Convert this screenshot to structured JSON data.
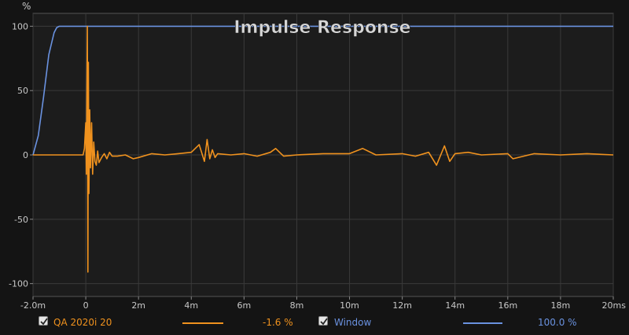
{
  "chart_data": {
    "type": "line",
    "title": "Impulse Response",
    "ylabel": "%",
    "xlabel": "",
    "xlim": [
      -2.0,
      20
    ],
    "ylim": [
      -110,
      110
    ],
    "x_ticks": [
      -2,
      0,
      2,
      4,
      6,
      8,
      10,
      12,
      14,
      16,
      18,
      20
    ],
    "x_tick_labels": [
      "-2.0m",
      "0",
      "2m",
      "4m",
      "6m",
      "8m",
      "10m",
      "12m",
      "14m",
      "16m",
      "18m",
      "20ms"
    ],
    "y_ticks": [
      100,
      50,
      0,
      -50,
      -100
    ],
    "y_tick_labels": [
      "100",
      "50",
      "0",
      "-50",
      "-100"
    ],
    "grid": true,
    "series": [
      {
        "name": "QA 2020i 20",
        "color": "#f0921e",
        "x": [
          -2.0,
          -0.1,
          -0.05,
          0.0,
          0.02,
          0.04,
          0.06,
          0.08,
          0.1,
          0.12,
          0.15,
          0.18,
          0.22,
          0.26,
          0.3,
          0.35,
          0.4,
          0.45,
          0.5,
          0.6,
          0.7,
          0.8,
          0.9,
          1.0,
          1.2,
          1.5,
          1.8,
          2.0,
          2.5,
          3.0,
          3.5,
          4.0,
          4.3,
          4.5,
          4.6,
          4.7,
          4.8,
          4.9,
          5.0,
          5.5,
          6.0,
          6.5,
          7.0,
          7.2,
          7.5,
          8.0,
          9.0,
          10.0,
          10.5,
          11.0,
          12.0,
          12.5,
          13.0,
          13.3,
          13.6,
          13.8,
          14.0,
          14.5,
          15.0,
          16.0,
          16.2,
          17.0,
          18.0,
          19.0,
          20.0
        ],
        "y": [
          0,
          0,
          5,
          25,
          -15,
          40,
          100,
          -91,
          72,
          -30,
          35,
          -10,
          25,
          -15,
          10,
          -5,
          -8,
          3,
          -6,
          -2,
          1,
          -3,
          2,
          -1,
          -1,
          0,
          -3,
          -2,
          1,
          0,
          1,
          2,
          8,
          -5,
          12,
          -3,
          4,
          -2,
          1,
          0,
          1,
          -1,
          2,
          5,
          -1,
          0,
          1,
          1,
          5,
          0,
          1,
          -1,
          2,
          -8,
          7,
          -5,
          1,
          2,
          0,
          1,
          -3,
          1,
          0,
          1,
          0
        ]
      },
      {
        "name": "Window",
        "color": "#6a92e0",
        "x": [
          -2.0,
          -1.8,
          -1.6,
          -1.4,
          -1.2,
          -1.1,
          -1.0,
          -0.9,
          20.0
        ],
        "y": [
          0,
          15,
          45,
          78,
          95,
          99,
          100,
          100,
          100
        ]
      }
    ]
  },
  "legend": {
    "items": [
      {
        "label": "QA 2020i 20",
        "value": "-1.6 %",
        "color": "#f0921e",
        "checked": true
      },
      {
        "label": "Window",
        "value": "100.0 %",
        "color": "#6a92e0",
        "checked": true
      }
    ]
  }
}
